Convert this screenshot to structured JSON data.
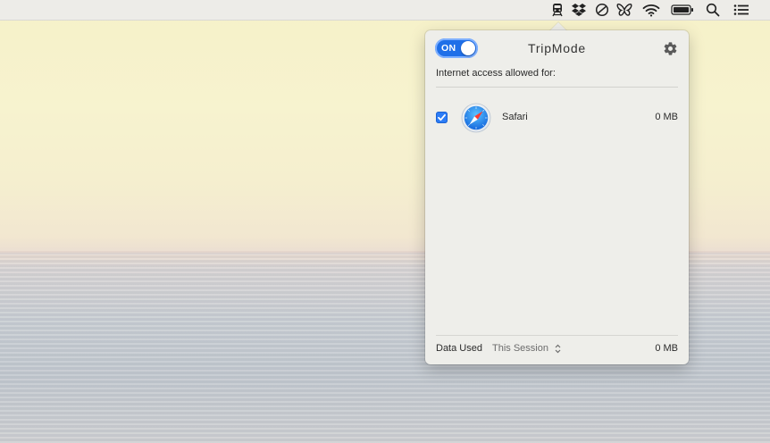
{
  "menubar": {
    "icons": [
      "tripmode-train-icon",
      "dropbox-icon",
      "no-entry-icon",
      "butterfly-icon",
      "wifi-icon",
      "battery-icon",
      "spotlight-search-icon",
      "notification-center-icon"
    ]
  },
  "popover": {
    "toggle_label": "ON",
    "title": "TripMode",
    "section_label": "Internet access allowed for:",
    "apps": [
      {
        "name": "Safari",
        "usage": "0 MB",
        "allowed": true,
        "icon": "safari-icon"
      }
    ],
    "footer": {
      "label": "Data Used",
      "period": "This Session",
      "total": "0 MB"
    }
  },
  "colors": {
    "accent": "#1f6fe8",
    "checkbox": "#2c7cf6",
    "popover_bg": "#eeeeea"
  }
}
